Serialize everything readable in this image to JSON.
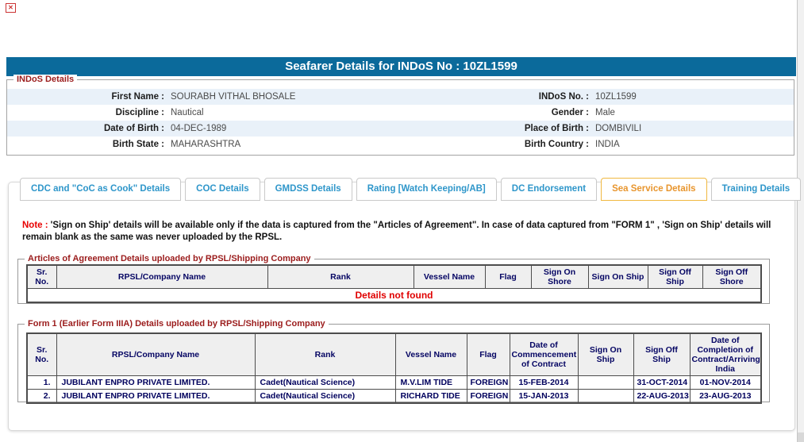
{
  "colors": {
    "titlebar_bg": "#0b6a9b",
    "legend_red": "#9b1c1c",
    "tab_inactive_blue": "#2e96ca",
    "tab_active_orange": "#e8952d",
    "note_red": "#e80000",
    "row_alt_blue": "#e9f1f9",
    "table_header_navy": "#050563",
    "error_red": "#e00000"
  },
  "icons": {
    "broken_image": "✕"
  },
  "header": {
    "title": "Seafarer Details for INDoS No : 10ZL1599"
  },
  "indos": {
    "legend": "INDoS Details",
    "rows": [
      {
        "l1": "First Name :",
        "v1": "SOURABH VITHAL BHOSALE",
        "l2": "INDoS No. :",
        "v2": "10ZL1599"
      },
      {
        "l1": "Discipline :",
        "v1": "Nautical",
        "l2": "Gender :",
        "v2": "Male"
      },
      {
        "l1": "Date of Birth :",
        "v1": "04-DEC-1989",
        "l2": "Place of Birth :",
        "v2": "DOMBIVILI"
      },
      {
        "l1": "Birth State :",
        "v1": "MAHARASHTRA",
        "l2": "Birth Country :",
        "v2": "INDIA"
      }
    ]
  },
  "tabs": {
    "items": [
      {
        "label": "CDC and \"CoC as Cook\" Details",
        "active": false
      },
      {
        "label": "COC Details",
        "active": false
      },
      {
        "label": "GMDSS Details",
        "active": false
      },
      {
        "label": "Rating [Watch Keeping/AB]",
        "active": false
      },
      {
        "label": "DC Endorsement",
        "active": false
      },
      {
        "label": "Sea Service Details",
        "active": true
      },
      {
        "label": "Training Details",
        "active": false
      }
    ]
  },
  "note": {
    "prefix": "Note :",
    "text": "'Sign on Ship' details will be available only if the data is captured from the \"Articles of Agreement\". In case of data captured from \"FORM 1\" , 'Sign on Ship' details will remain blank as the same was never uploaded by the RPSL."
  },
  "aoa_table": {
    "legend": "Articles of Agreement Details uploaded by RPSL/Shipping Company",
    "headers": [
      "Sr. No.",
      "RPSL/Company Name",
      "Rank",
      "Vessel Name",
      "Flag",
      "Sign On Shore",
      "Sign On Ship",
      "Sign Off Ship",
      "Sign Off Shore"
    ],
    "empty_message": "Details not found"
  },
  "form1_table": {
    "legend": "Form 1 (Earlier Form IIIA) Details uploaded by RPSL/Shipping Company",
    "headers": [
      "Sr. No.",
      "RPSL/Company Name",
      "Rank",
      "Vessel Name",
      "Flag",
      "Date of Commencement of Contract",
      "Sign On Ship",
      "Sign Off Ship",
      "Date of Completion of Contract/Arriving India"
    ],
    "rows": [
      [
        "1.",
        "JUBILANT ENPRO PRIVATE LIMITED.",
        "Cadet(Nautical Science)",
        "M.V.LIM TIDE",
        "FOREIGN",
        "15-FEB-2014",
        "",
        "31-OCT-2014",
        "01-NOV-2014"
      ],
      [
        "2.",
        "JUBILANT ENPRO PRIVATE LIMITED.",
        "Cadet(Nautical Science)",
        "RICHARD TIDE",
        "FOREIGN",
        "15-JAN-2013",
        "",
        "22-AUG-2013",
        "23-AUG-2013"
      ]
    ]
  }
}
